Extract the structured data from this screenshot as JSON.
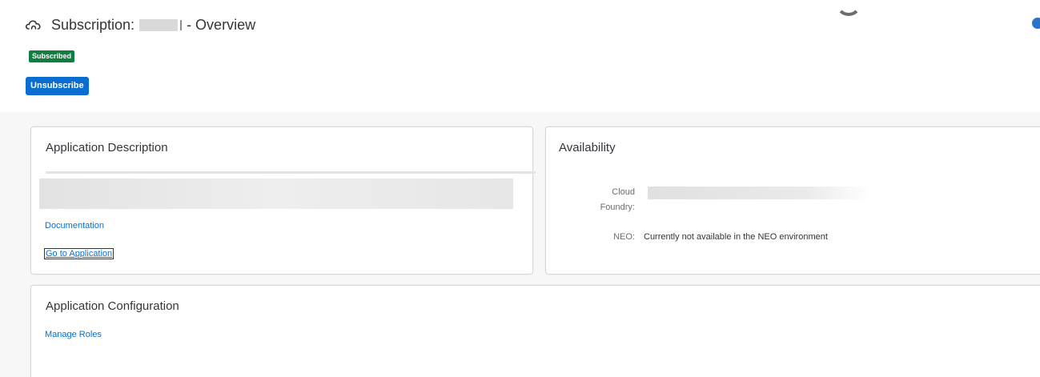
{
  "header": {
    "title_prefix": "Subscription:",
    "title_suffix": "- Overview",
    "status_badge": "Subscribed",
    "unsubscribe_label": "Unsubscribe"
  },
  "description_card": {
    "title": "Application Description",
    "documentation_link": "Documentation",
    "go_to_app_link": "Go to Application"
  },
  "availability_card": {
    "title": "Availability",
    "cloud_foundry_label_line1": "Cloud",
    "cloud_foundry_label_line2": "Foundry:",
    "neo_label": "NEO:",
    "neo_value": "Currently not available in the NEO environment"
  },
  "config_card": {
    "title": "Application Configuration",
    "manage_roles_link": "Manage Roles"
  },
  "colors": {
    "brand_blue": "#0a6ed1",
    "success_green": "#107e3e",
    "text": "#32363a",
    "background": "#f7f7f7"
  },
  "icons": {
    "title_icon": "cloud-icon",
    "loading": "busy-indicator-icon"
  }
}
